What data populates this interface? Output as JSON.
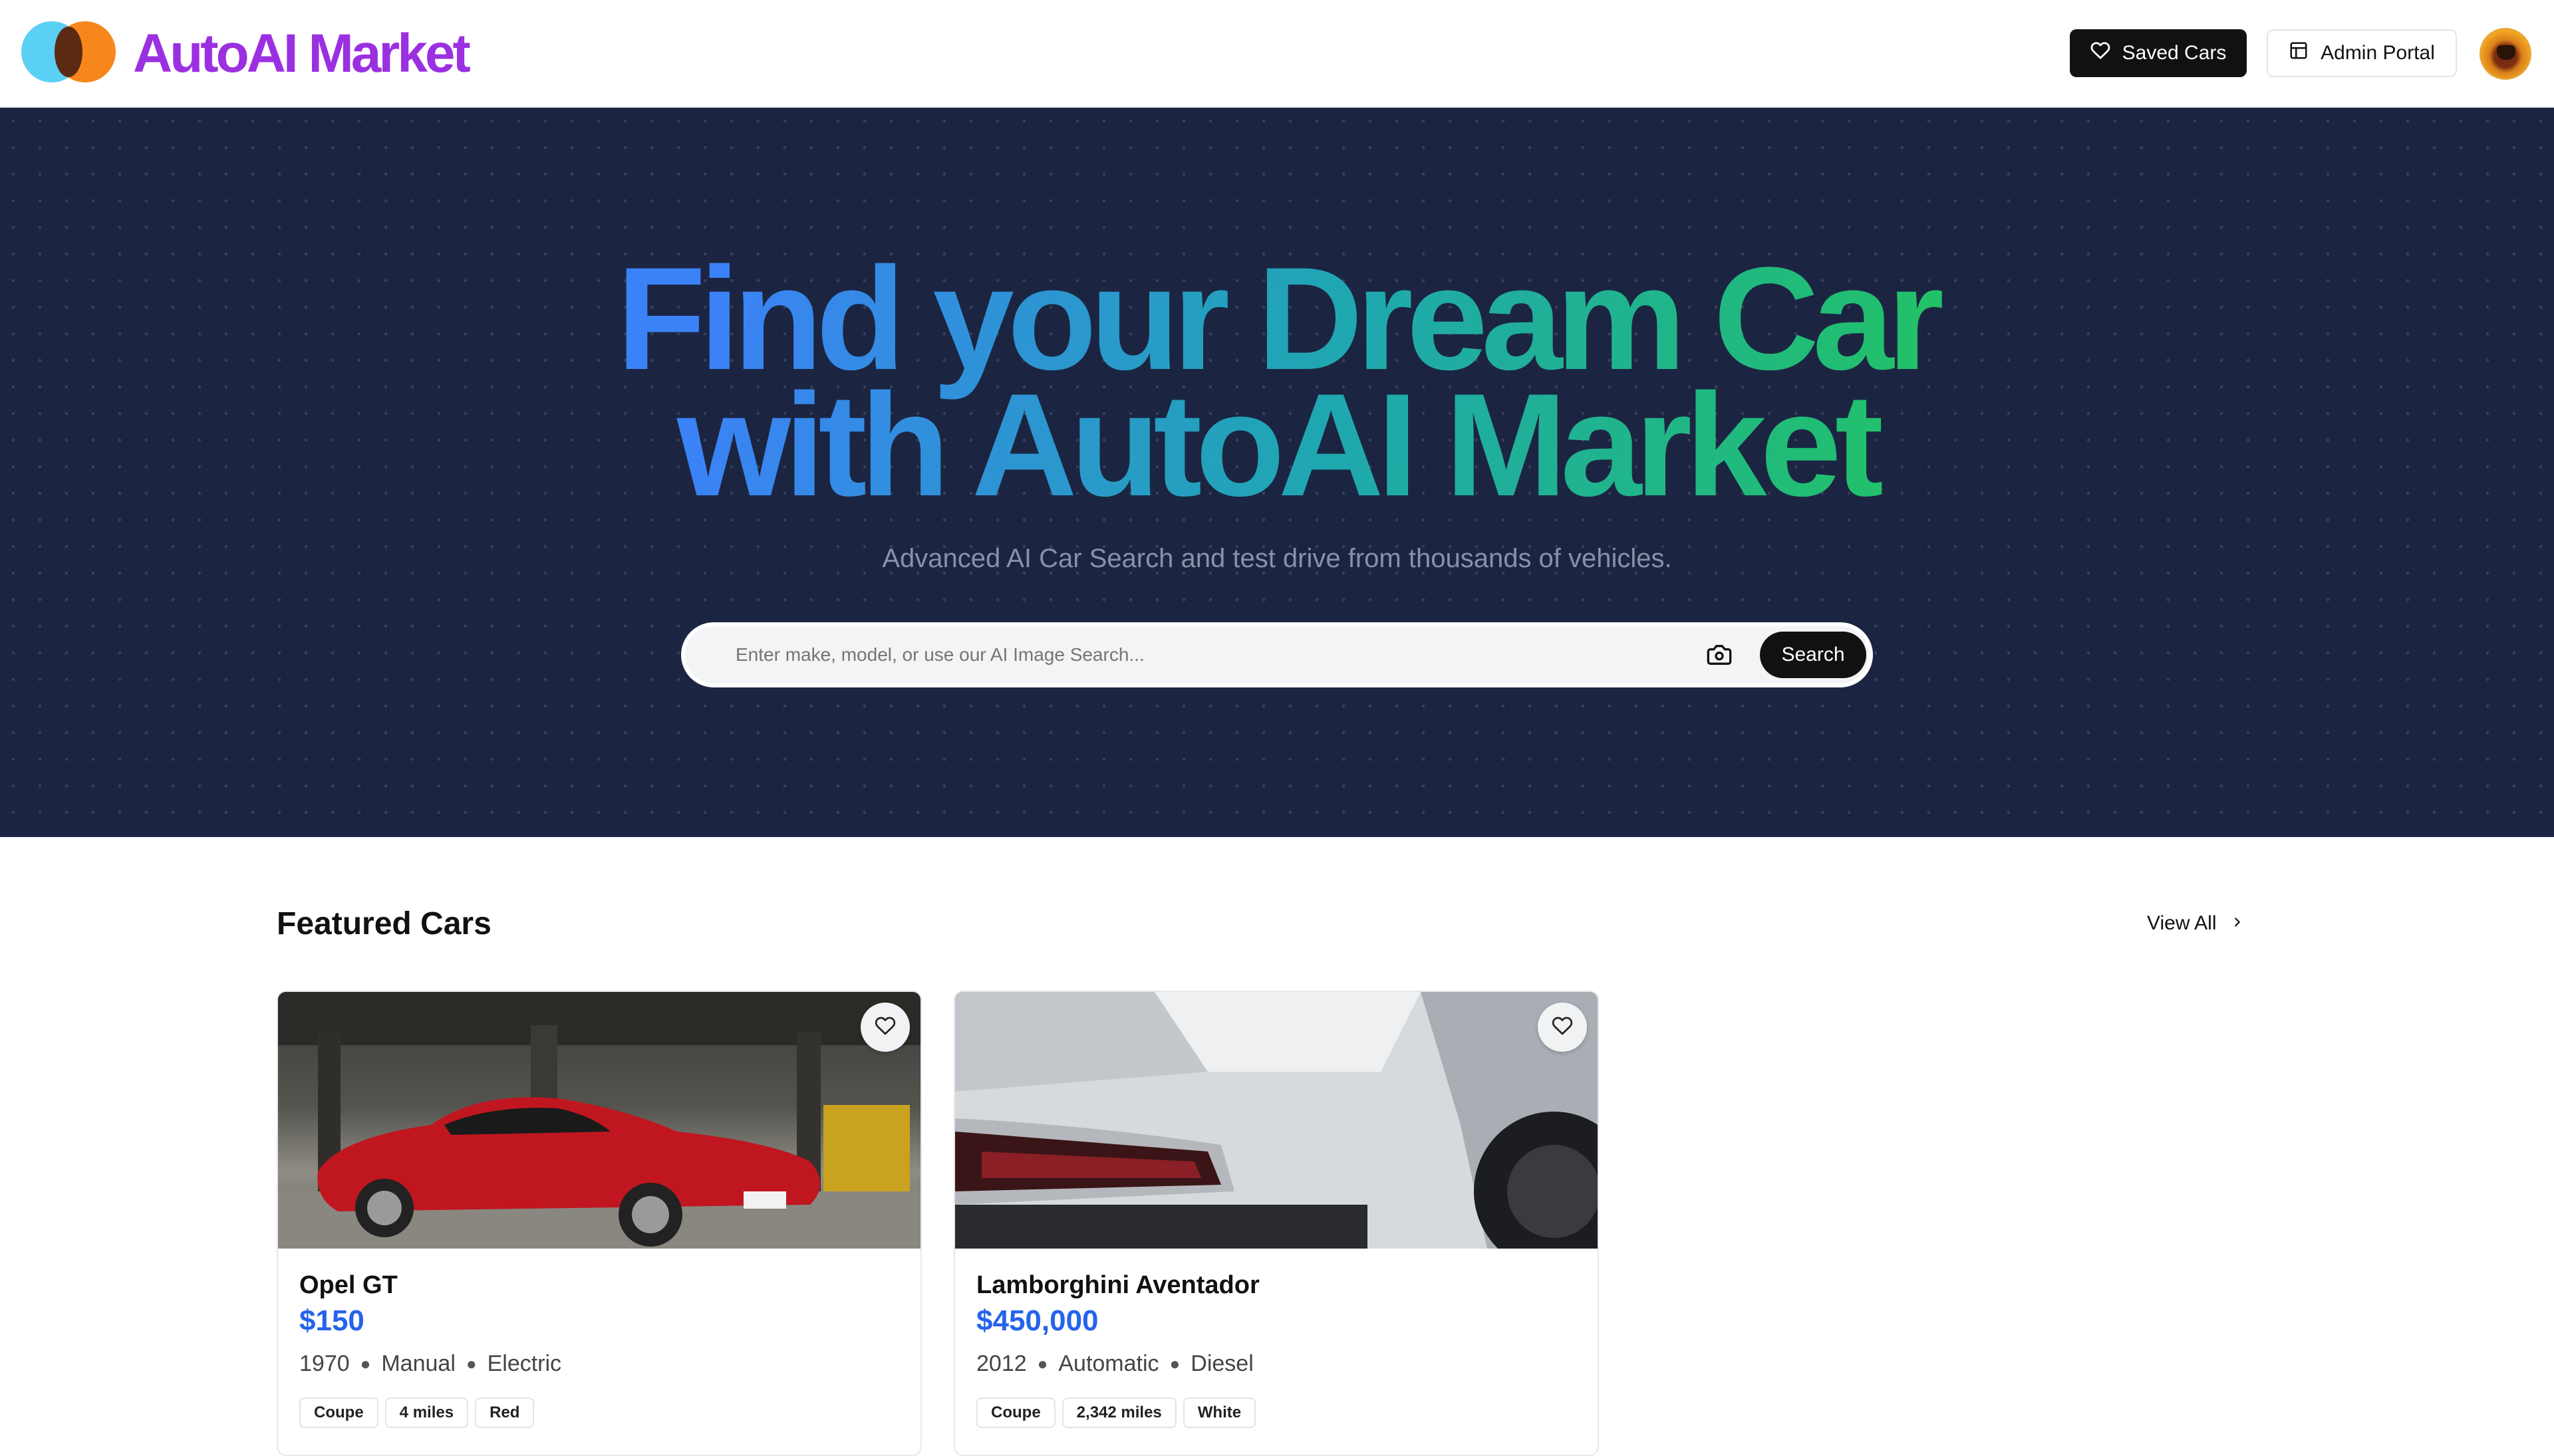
{
  "header": {
    "brand": "AutoAI Market",
    "saved_cars_label": "Saved Cars",
    "admin_portal_label": "Admin Portal"
  },
  "hero": {
    "headline_line1": "Find your Dream Car",
    "headline_line2": "with AutoAI Market",
    "subtitle": "Advanced AI Car Search and test drive from thousands of vehicles.",
    "search_placeholder": "Enter make, model, or use our AI Image Search...",
    "search_button_label": "Search"
  },
  "featured": {
    "title": "Featured Cars",
    "view_all_label": "View All",
    "cars": [
      {
        "name": "Opel GT",
        "price": "$150",
        "year": "1970",
        "transmission": "Manual",
        "fuel": "Electric",
        "tags": [
          "Coupe",
          "4 miles",
          "Red"
        ]
      },
      {
        "name": "Lamborghini Aventador",
        "price": "$450,000",
        "year": "2012",
        "transmission": "Automatic",
        "fuel": "Diesel",
        "tags": [
          "Coupe",
          "2,342 miles",
          "White"
        ]
      }
    ]
  },
  "icons": {
    "saved_cars": "heart-icon",
    "admin_portal": "layout-icon",
    "search": "camera-icon",
    "view_all": "chevron-right-icon",
    "favorite": "heart-icon"
  },
  "colors": {
    "brand": "#9b30e0",
    "hero_bg": "#1b2542",
    "price": "#2563eb",
    "headline_gradient": [
      "#3b82f6",
      "#1fa7b1",
      "#22c55e"
    ]
  }
}
